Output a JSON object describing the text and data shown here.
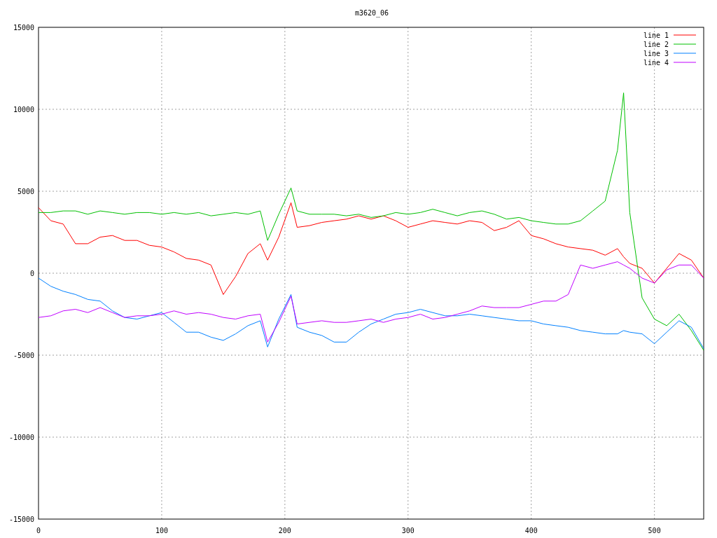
{
  "chart_data": {
    "type": "line",
    "title": "m3620_06",
    "x": [
      0,
      10,
      20,
      30,
      40,
      50,
      60,
      70,
      80,
      90,
      100,
      110,
      120,
      130,
      140,
      150,
      160,
      170,
      180,
      186,
      195,
      205,
      210,
      220,
      230,
      240,
      250,
      260,
      270,
      280,
      290,
      300,
      310,
      320,
      330,
      340,
      350,
      360,
      370,
      380,
      390,
      400,
      410,
      420,
      430,
      440,
      450,
      460,
      470,
      475,
      480,
      490,
      500,
      510,
      520,
      530,
      540
    ],
    "series": [
      {
        "name": "line 1",
        "color": "#ff0000",
        "values": [
          4000,
          3200,
          3000,
          1800,
          1800,
          2200,
          2300,
          2000,
          2000,
          1700,
          1600,
          1300,
          900,
          800,
          500,
          -1300,
          -200,
          1200,
          1800,
          800,
          2200,
          4300,
          2800,
          2900,
          3100,
          3200,
          3300,
          3500,
          3300,
          3500,
          3200,
          2800,
          3000,
          3200,
          3100,
          3000,
          3200,
          3100,
          2600,
          2800,
          3200,
          2300,
          2100,
          1800,
          1600,
          1500,
          1400,
          1100,
          1500,
          1000,
          600,
          300,
          -600,
          300,
          1200,
          800,
          -300
        ]
      },
      {
        "name": "line 2",
        "color": "#00c000",
        "values": [
          3700,
          3700,
          3800,
          3800,
          3600,
          3800,
          3700,
          3600,
          3700,
          3700,
          3600,
          3700,
          3600,
          3700,
          3500,
          3600,
          3700,
          3600,
          3800,
          2000,
          3600,
          5200,
          3800,
          3600,
          3600,
          3600,
          3500,
          3600,
          3400,
          3500,
          3700,
          3600,
          3700,
          3900,
          3700,
          3500,
          3700,
          3800,
          3600,
          3300,
          3400,
          3200,
          3100,
          3000,
          3000,
          3200,
          3800,
          4400,
          7500,
          11000,
          3700,
          -1500,
          -2800,
          -3200,
          -2500,
          -3500,
          -4700
        ]
      },
      {
        "name": "line 3",
        "color": "#0080ff",
        "values": [
          -300,
          -800,
          -1100,
          -1300,
          -1600,
          -1700,
          -2300,
          -2700,
          -2800,
          -2600,
          -2400,
          -3000,
          -3600,
          -3600,
          -3900,
          -4100,
          -3700,
          -3200,
          -2900,
          -4500,
          -2800,
          -1300,
          -3300,
          -3600,
          -3800,
          -4200,
          -4200,
          -3600,
          -3100,
          -2800,
          -2500,
          -2400,
          -2200,
          -2400,
          -2600,
          -2600,
          -2500,
          -2600,
          -2700,
          -2800,
          -2900,
          -2900,
          -3100,
          -3200,
          -3300,
          -3500,
          -3600,
          -3700,
          -3700,
          -3500,
          -3600,
          -3700,
          -4300,
          -3600,
          -2900,
          -3300,
          -4600
        ]
      },
      {
        "name": "line 4",
        "color": "#c000ff",
        "values": [
          -2700,
          -2600,
          -2300,
          -2200,
          -2400,
          -2100,
          -2400,
          -2700,
          -2600,
          -2600,
          -2500,
          -2300,
          -2500,
          -2400,
          -2500,
          -2700,
          -2800,
          -2600,
          -2500,
          -4200,
          -3000,
          -1400,
          -3100,
          -3000,
          -2900,
          -3000,
          -3000,
          -2900,
          -2800,
          -3000,
          -2800,
          -2700,
          -2500,
          -2800,
          -2700,
          -2500,
          -2300,
          -2000,
          -2100,
          -2100,
          -2100,
          -1900,
          -1700,
          -1700,
          -1300,
          500,
          300,
          500,
          700,
          500,
          300,
          -300,
          -600,
          200,
          500,
          500,
          -300
        ]
      }
    ],
    "xlim": [
      0,
      540
    ],
    "ylim": [
      -15000,
      15000
    ],
    "xticks": [
      0,
      100,
      200,
      300,
      400,
      500
    ],
    "yticks": [
      -15000,
      -10000,
      -5000,
      0,
      5000,
      10000,
      15000
    ],
    "grid": true,
    "legend": true
  }
}
